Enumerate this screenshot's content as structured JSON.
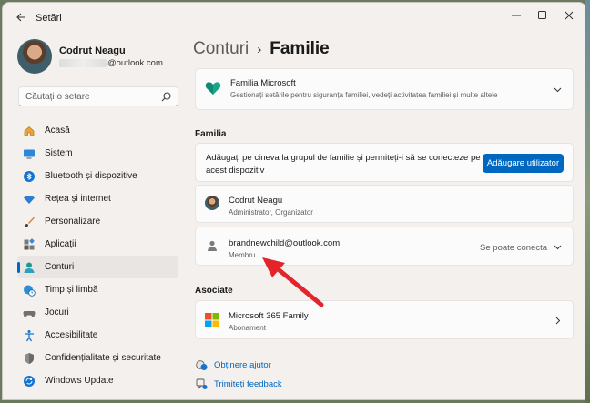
{
  "window": {
    "title": "Setări"
  },
  "profile": {
    "name": "Codrut Neagu",
    "email_suffix": "@outlook.com"
  },
  "search": {
    "placeholder": "Căutați o setare"
  },
  "sidebar": {
    "items": [
      {
        "label": "Acasă",
        "icon": "home-icon",
        "active": false
      },
      {
        "label": "Sistem",
        "icon": "system-icon",
        "active": false
      },
      {
        "label": "Bluetooth și dispozitive",
        "icon": "bluetooth-icon",
        "active": false
      },
      {
        "label": "Rețea și internet",
        "icon": "wifi-icon",
        "active": false
      },
      {
        "label": "Personalizare",
        "icon": "brush-icon",
        "active": false
      },
      {
        "label": "Aplicații",
        "icon": "apps-icon",
        "active": false
      },
      {
        "label": "Conturi",
        "icon": "person-icon",
        "active": true
      },
      {
        "label": "Timp și limbă",
        "icon": "globe-clock-icon",
        "active": false
      },
      {
        "label": "Jocuri",
        "icon": "gamepad-icon",
        "active": false
      },
      {
        "label": "Accesibilitate",
        "icon": "accessibility-icon",
        "active": false
      },
      {
        "label": "Confidențialitate și securitate",
        "icon": "shield-icon",
        "active": false
      },
      {
        "label": "Windows Update",
        "icon": "update-icon",
        "active": false
      }
    ]
  },
  "breadcrumb": {
    "parent": "Conturi",
    "separator": "›",
    "current": "Familie"
  },
  "family_banner": {
    "title": "Familia Microsoft",
    "subtitle": "Gestionați setările pentru siguranța familiei, vedeți activitatea familiei și multe altele"
  },
  "family_section": {
    "label": "Familia",
    "add_text_line1": "Adăugați pe cineva la grupul de familie și permiteți-i să se conecteze pe",
    "add_text_line2": "acest dispozitiv",
    "add_button": "Adăugare utilizator",
    "members": [
      {
        "name": "Codrut Neagu",
        "role": "Administrator, Organizator"
      },
      {
        "name": "brandnewchild@outlook.com",
        "role": "Membru",
        "status": "Se poate conecta"
      }
    ]
  },
  "associated_section": {
    "label": "Asociate",
    "item": {
      "title": "Microsoft 365 Family",
      "subtitle": "Abonament"
    }
  },
  "links": {
    "help": "Obținere ajutor",
    "feedback": "Trimiteți feedback"
  },
  "colors": {
    "accent": "#0067c0",
    "annotation_arrow": "#e3242b"
  }
}
